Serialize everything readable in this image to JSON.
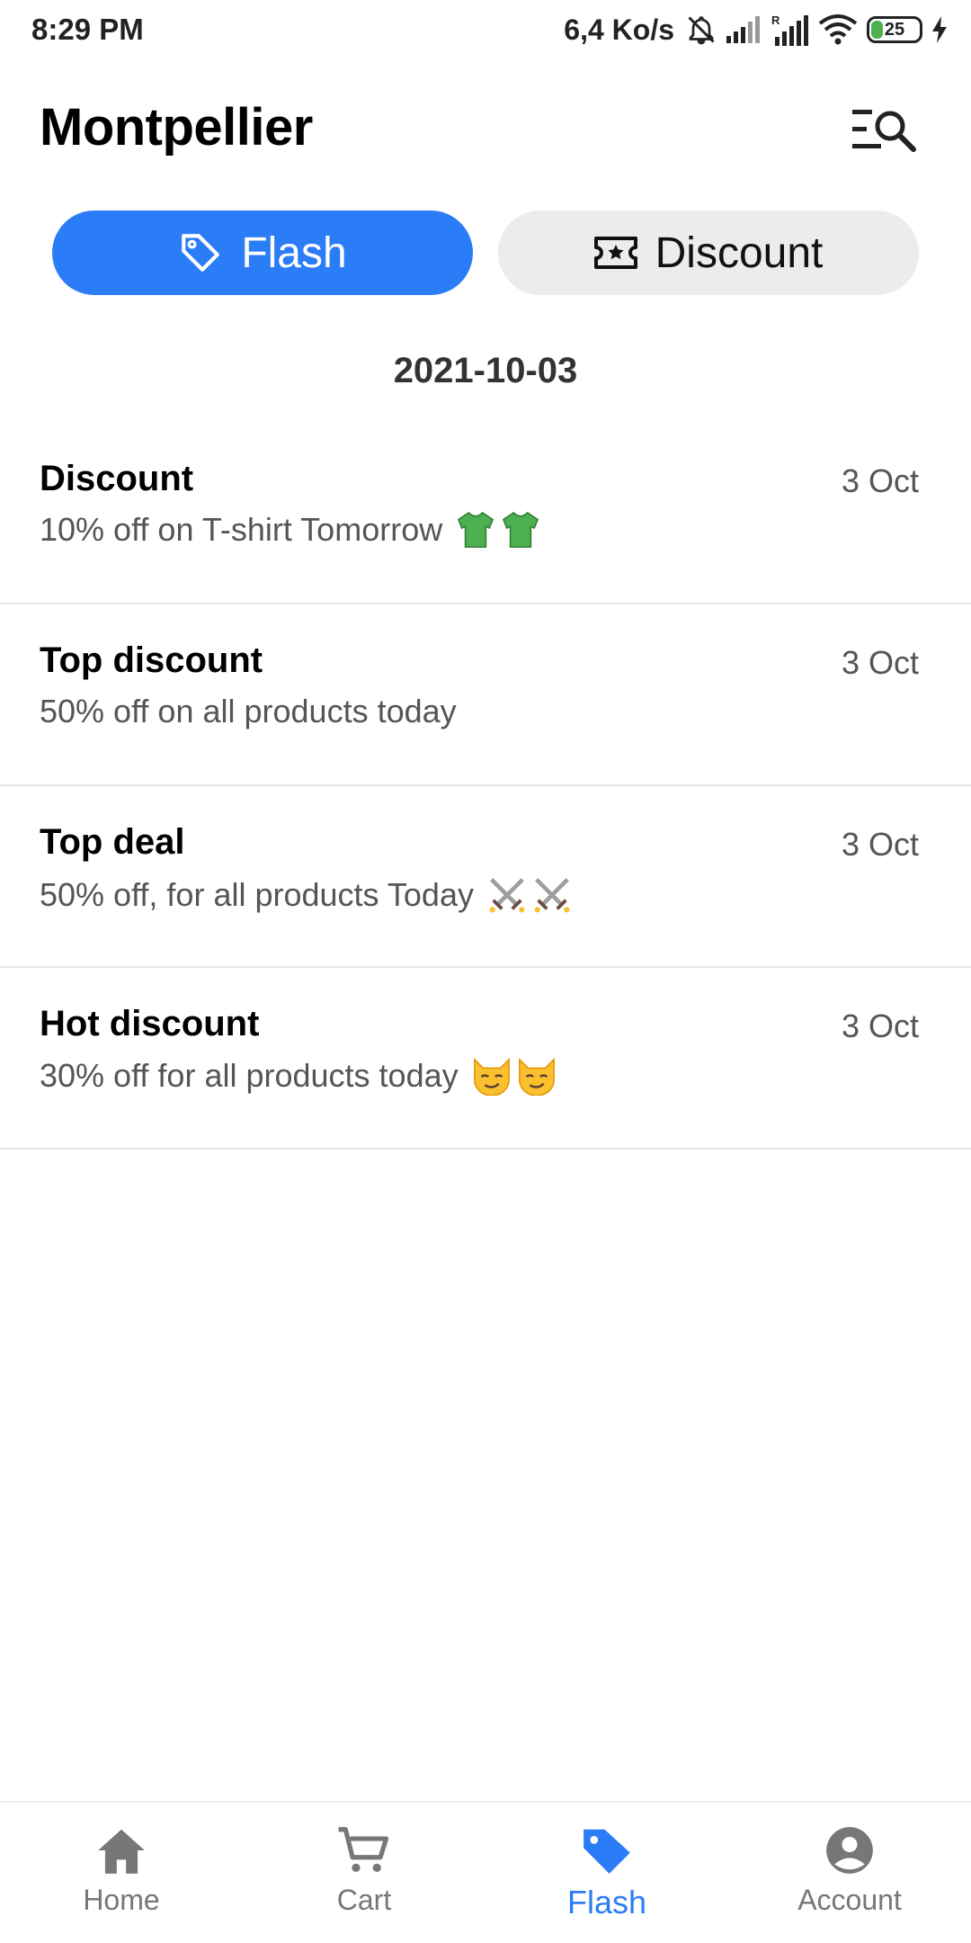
{
  "status_bar": {
    "time": "8:29 PM",
    "net_speed": "6,4 Ko/s",
    "battery_level": "25",
    "battery_fraction": 0.25,
    "icons": [
      "mute-icon",
      "signal-icon",
      "signal-roaming-icon",
      "wifi-icon",
      "battery-icon",
      "charging-icon"
    ]
  },
  "header": {
    "title": "Montpellier",
    "action_icon": "search-menu-icon"
  },
  "tabs": [
    {
      "label": "Flash",
      "icon": "tag-icon",
      "active": true
    },
    {
      "label": "Discount",
      "icon": "ticket-icon",
      "active": false
    }
  ],
  "date_heading": "2021-10-03",
  "offers": [
    {
      "title": "Discount",
      "description": "10% off on T-shirt Tomorrow",
      "emoji": "t-shirt-emoji",
      "date": "3 Oct"
    },
    {
      "title": "Top discount",
      "description": "50% off on all products today",
      "emoji": "",
      "date": "3 Oct"
    },
    {
      "title": "Top deal",
      "description": "50% off, for all products Today",
      "emoji": "crossed-swords-emoji",
      "date": "3 Oct"
    },
    {
      "title": "Hot discount",
      "description": "30% off for all products today",
      "emoji": "smirking-cat-emoji",
      "date": "3 Oct"
    }
  ],
  "bottom_nav": [
    {
      "label": "Home",
      "icon": "home-icon",
      "active": false
    },
    {
      "label": "Cart",
      "icon": "cart-icon",
      "active": false
    },
    {
      "label": "Flash",
      "icon": "tag-icon",
      "active": true
    },
    {
      "label": "Account",
      "icon": "account-icon",
      "active": false
    }
  ],
  "colors": {
    "accent": "#2a7cf7",
    "inactive_tab_bg": "#ececec",
    "muted_text": "#555555",
    "nav_inactive": "#777777"
  }
}
